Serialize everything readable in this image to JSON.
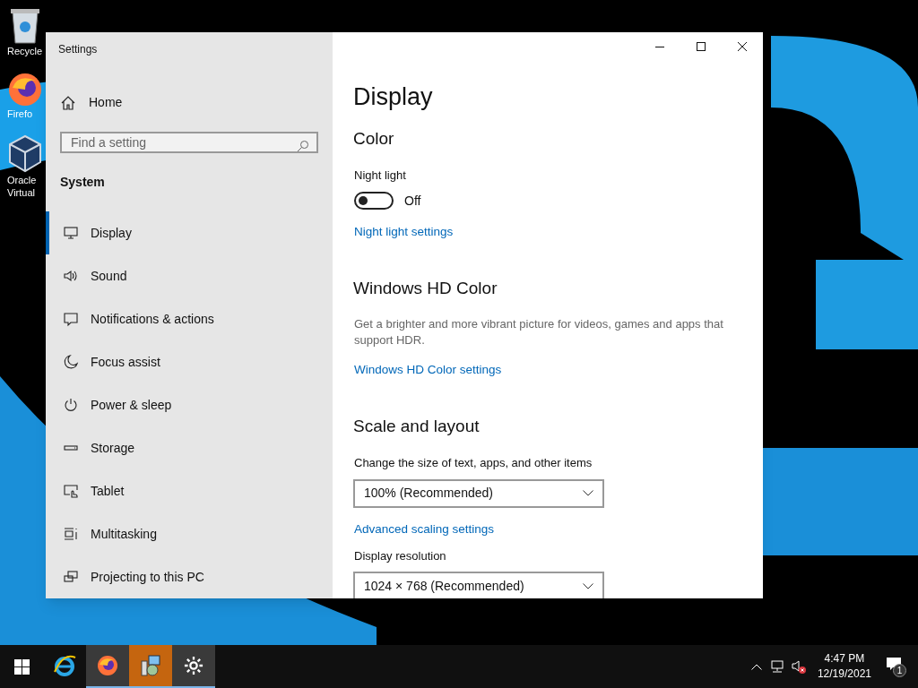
{
  "desktop_icons": [
    {
      "label": "Recycle",
      "kind": "bin"
    },
    {
      "label": "Firefo",
      "kind": "firefox"
    },
    {
      "label": "Oracle\nVirtual",
      "kind": "box"
    }
  ],
  "window": {
    "title": "Settings"
  },
  "sidebar": {
    "home": "Home",
    "search": {
      "placeholder": "Find a setting"
    },
    "section": "System",
    "items": [
      {
        "label": "Display",
        "kind": "monitor",
        "selected": true
      },
      {
        "label": "Sound",
        "kind": "speaker",
        "selected": false
      },
      {
        "label": "Notifications & actions",
        "kind": "message",
        "selected": false
      },
      {
        "label": "Focus assist",
        "kind": "moon",
        "selected": false
      },
      {
        "label": "Power & sleep",
        "kind": "power",
        "selected": false
      },
      {
        "label": "Storage",
        "kind": "drive",
        "selected": false
      },
      {
        "label": "Tablet",
        "kind": "tablet",
        "selected": false
      },
      {
        "label": "Multitasking",
        "kind": "multitask",
        "selected": false
      },
      {
        "label": "Projecting to this PC",
        "kind": "project",
        "selected": false
      }
    ]
  },
  "content": {
    "title": "Display",
    "sections": [
      {
        "heading": "Color",
        "items": [
          {
            "kind": "label",
            "text": "Night light"
          },
          {
            "kind": "toggle",
            "on": false,
            "text": "Off"
          },
          {
            "kind": "link",
            "text": "Night light settings"
          }
        ]
      },
      {
        "heading": "Windows HD Color",
        "items": [
          {
            "kind": "description",
            "text": "Get a brighter and more vibrant picture for videos, games and apps that support HDR."
          },
          {
            "kind": "link",
            "text": "Windows HD Color settings"
          }
        ]
      },
      {
        "heading": "Scale and layout",
        "items": [
          {
            "kind": "label",
            "text": "Change the size of text, apps, and other items"
          },
          {
            "kind": "dropdown",
            "text": "100% (Recommended)"
          },
          {
            "kind": "link",
            "text": "Advanced scaling settings"
          },
          {
            "kind": "label",
            "text": "Display resolution"
          },
          {
            "kind": "dropdown",
            "text": "1024 × 768 (Recommended)"
          }
        ]
      }
    ]
  },
  "taskbar": {
    "apps": [
      {
        "kind": "ie",
        "running": false,
        "selected": false
      },
      {
        "kind": "firefox",
        "running": true,
        "selected": false
      },
      {
        "kind": "installer",
        "running": true,
        "selected": true
      },
      {
        "kind": "settings",
        "running": true,
        "selected": false
      }
    ],
    "time": "4:47 PM",
    "date": "12/19/2021",
    "notification_count": "1"
  }
}
